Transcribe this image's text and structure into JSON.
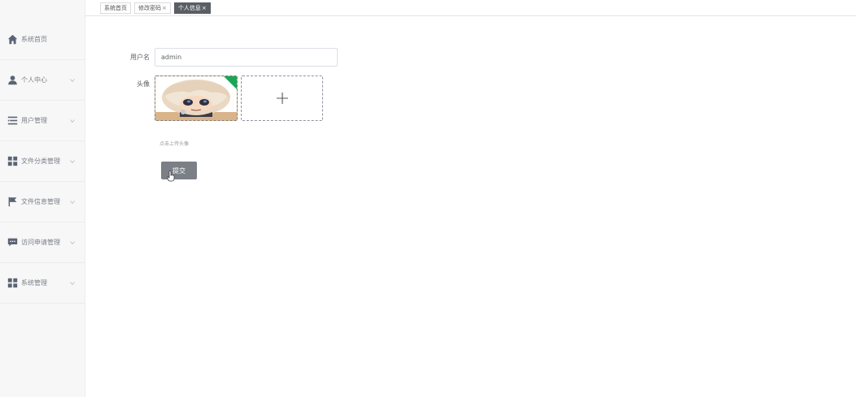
{
  "tabs": [
    {
      "label": "系统首页",
      "closable": false,
      "active": false
    },
    {
      "label": "修改密码",
      "closable": true,
      "active": false
    },
    {
      "label": "个人信息",
      "closable": true,
      "active": true
    }
  ],
  "tab_close_glyph": "×",
  "sidebar": {
    "items": [
      {
        "label": "系统首页",
        "icon": "home-icon",
        "expandable": false
      },
      {
        "label": "个人中心",
        "icon": "user-icon",
        "expandable": true
      },
      {
        "label": "用户管理",
        "icon": "list-icon",
        "expandable": true
      },
      {
        "label": "文件分类管理",
        "icon": "grid-icon",
        "expandable": true
      },
      {
        "label": "文件信息管理",
        "icon": "flag-icon",
        "expandable": true
      },
      {
        "label": "访问申请管理",
        "icon": "chat-icon",
        "expandable": true
      },
      {
        "label": "系统管理",
        "icon": "grid-icon",
        "expandable": true
      }
    ]
  },
  "form": {
    "username_label": "用户名",
    "username_value": "admin",
    "avatar_label": "头像",
    "upload_hint": "点击上传头像",
    "submit_label": "提交"
  },
  "colors": {
    "active_tab_bg": "#5a5f66",
    "submit_bg": "#7b8087",
    "avatar_corner": "#17a857"
  }
}
